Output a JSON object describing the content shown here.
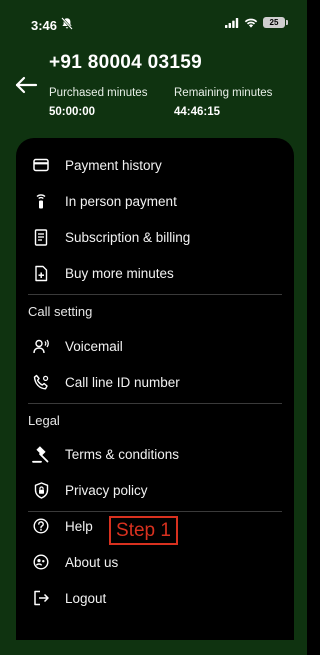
{
  "status_bar": {
    "time": "3:46",
    "battery": "25",
    "icons": [
      "bell-off-icon",
      "cellular-signal-icon",
      "wifi-icon",
      "battery-icon"
    ]
  },
  "header": {
    "back_icon": "arrow-left-icon",
    "phone_number": "+91 80004 03159",
    "purchased_label": "Purchased minutes",
    "purchased_value": "50:00:00",
    "remaining_label": "Remaining minutes",
    "remaining_value": "44:46:15"
  },
  "menu": {
    "payment_items": [
      {
        "label": "Payment history",
        "icon": "credit-card-icon"
      },
      {
        "label": "In person payment",
        "icon": "contactless-payment-icon"
      },
      {
        "label": "Subscription & billing",
        "icon": "receipt-icon"
      },
      {
        "label": "Buy more minutes",
        "icon": "add-document-icon"
      }
    ],
    "call_setting_title": "Call setting",
    "call_items": [
      {
        "label": "Voicemail",
        "icon": "voicemail-icon"
      },
      {
        "label": "Call line ID number",
        "icon": "phone-settings-icon"
      }
    ],
    "legal_title": "Legal",
    "legal_items": [
      {
        "label": "Terms & conditions",
        "icon": "gavel-icon"
      },
      {
        "label": "Privacy policy",
        "icon": "shield-lock-icon"
      }
    ],
    "other_items": [
      {
        "label": "Help",
        "icon": "help-icon"
      },
      {
        "label": "About us",
        "icon": "about-icon"
      },
      {
        "label": "Logout",
        "icon": "logout-icon"
      }
    ]
  },
  "annotation": {
    "step_label": "Step 1",
    "color": "#d8311f"
  },
  "colors": {
    "header_bg": "#0f3310",
    "sheet_bg": "#000000"
  }
}
